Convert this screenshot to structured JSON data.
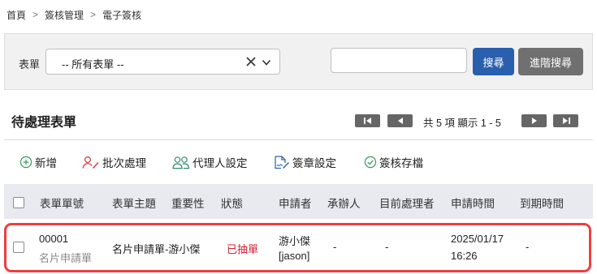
{
  "breadcrumb": {
    "items": [
      "首頁",
      "簽核管理",
      "電子簽核"
    ]
  },
  "filter": {
    "label": "表單",
    "select_value": "-- 所有表單 --",
    "search_value": "",
    "search_placeholder": "",
    "search_button": "搜尋",
    "advanced_button": "進階搜尋"
  },
  "section": {
    "title": "待處理表單"
  },
  "pager": {
    "text": "共 5 項 顯示 1 - 5"
  },
  "toolbar": {
    "add": "新增",
    "batch": "批次處理",
    "proxy": "代理人設定",
    "stamp": "簽章設定",
    "archive": "簽核存檔"
  },
  "table": {
    "headers": {
      "form_no": "表單單號",
      "subject": "表單主題",
      "importance": "重要性",
      "status": "狀態",
      "applicant": "申請者",
      "handler": "承辦人",
      "current": "目前處理者",
      "apply_time": "申請時間",
      "due_time": "到期時間"
    },
    "rows": [
      {
        "form_no": "00001",
        "form_type": "名片申請單",
        "subject": "名片申請單-游小傑",
        "status": "已抽單",
        "applicant_name": "游小傑",
        "applicant_id": "[jason]",
        "handler": "-",
        "current": "-",
        "apply_date": "2025/01/17",
        "apply_clock": "16:26",
        "due_time": "-"
      }
    ]
  },
  "colors": {
    "primary": "#2a5fae",
    "secondary": "#707070",
    "highlight": "#ee3e40",
    "status_withdrawn": "#d0202e"
  }
}
